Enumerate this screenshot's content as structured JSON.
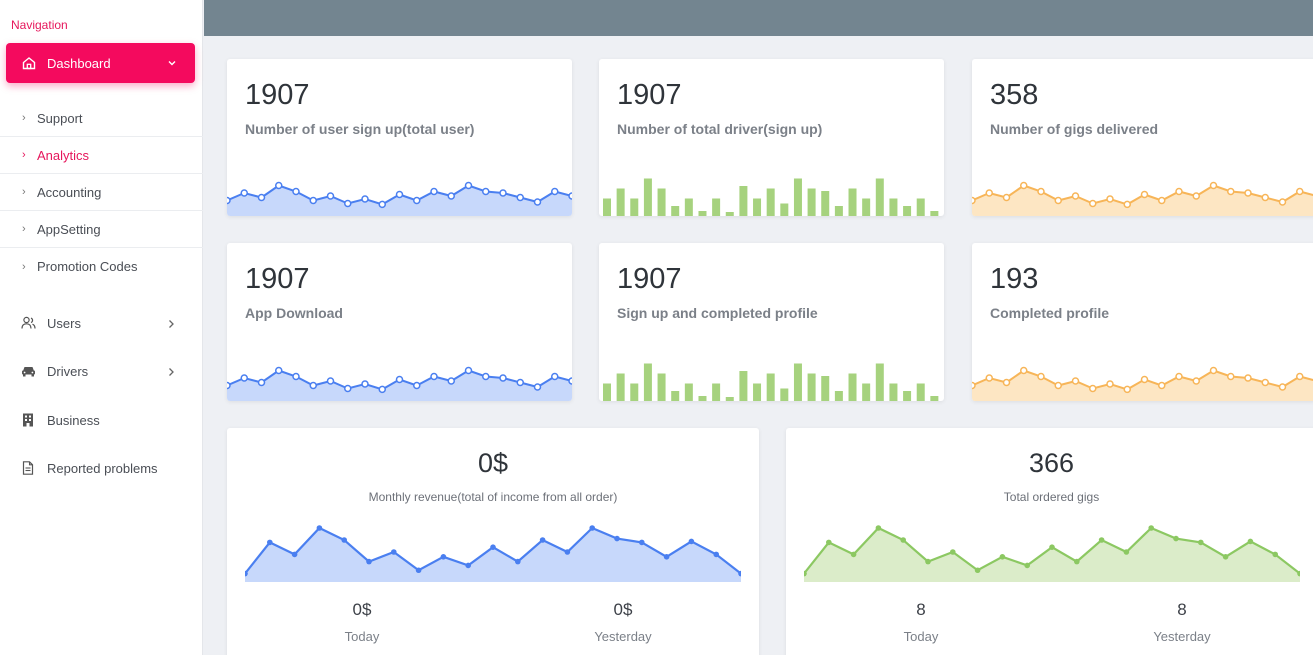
{
  "sidebar": {
    "title": "Navigation",
    "dashboard": {
      "label": "Dashboard",
      "icon": "home-icon"
    },
    "sub_items": [
      {
        "label": "Support",
        "active": false
      },
      {
        "label": "Analytics",
        "active": true
      },
      {
        "label": "Accounting",
        "active": false
      },
      {
        "label": "AppSetting",
        "active": false
      },
      {
        "label": "Promotion Codes",
        "active": false
      }
    ],
    "main_items": [
      {
        "label": "Users",
        "icon": "users-icon"
      },
      {
        "label": "Drivers",
        "icon": "car-icon"
      },
      {
        "label": "Business",
        "icon": "building-icon"
      },
      {
        "label": "Reported problems",
        "icon": "file-icon"
      }
    ]
  },
  "colors": {
    "accent": "#f40a5e",
    "topbar": "#738590",
    "blue": "#4a7ff0",
    "blue_fill": "#c7d8fb",
    "green": "#8cc862",
    "green_bar": "#a6d27e",
    "orange": "#f7b558",
    "orange_fill": "#fde6c3"
  },
  "stats": [
    {
      "value": "1907",
      "label": "Number of user sign up(total user)",
      "chart": "blue-line"
    },
    {
      "value": "1907",
      "label": "Number of total driver(sign up)",
      "chart": "green-bar"
    },
    {
      "value": "358",
      "label": "Number of gigs delivered",
      "chart": "orange-line"
    },
    {
      "value": "1907",
      "label": "App Download",
      "chart": "blue-line"
    },
    {
      "value": "1907",
      "label": "Sign up and completed profile",
      "chart": "green-bar"
    },
    {
      "value": "193",
      "label": "Completed profile",
      "chart": "orange-line"
    }
  ],
  "revenue": {
    "value": "0$",
    "label": "Monthly revenue(total of income from all order)",
    "today_value": "0$",
    "today_label": "Today",
    "yesterday_value": "0$",
    "yesterday_label": "Yesterday"
  },
  "gigs": {
    "value": "366",
    "label": "Total ordered gigs",
    "today_value": "8",
    "today_label": "Today",
    "yesterday_value": "8",
    "yesterday_label": "Yesterday"
  }
}
